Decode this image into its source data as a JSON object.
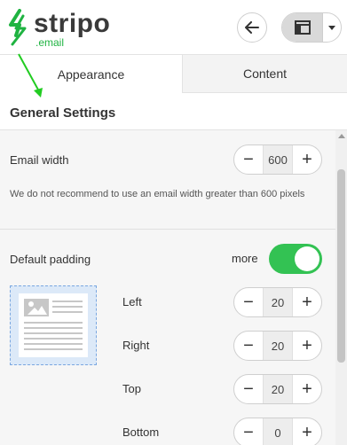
{
  "header": {
    "logo_text": "stripo",
    "logo_sub": ".email",
    "back_icon": "arrow-left-icon",
    "layout_icon": "panel-layout-icon",
    "dropdown_icon": "chevron-down-icon"
  },
  "tabs": [
    {
      "label": "Appearance",
      "active": true
    },
    {
      "label": "Content",
      "active": false
    }
  ],
  "section_title": "General Settings",
  "email_width": {
    "label": "Email width",
    "value": "600",
    "note": "We do not recommend to use an email width greater than 600 pixels"
  },
  "default_padding": {
    "label": "Default padding",
    "more_label": "more",
    "toggle_on": true,
    "left": {
      "label": "Left",
      "value": "20"
    },
    "right": {
      "label": "Right",
      "value": "20"
    },
    "top": {
      "label": "Top",
      "value": "20"
    },
    "bottom": {
      "label": "Bottom",
      "value": "0"
    }
  },
  "stepper": {
    "minus": "−",
    "plus": "+"
  },
  "colors": {
    "accent_green": "#33c253",
    "brand_green": "#1fb341",
    "annotation_arrow": "#22cc22"
  }
}
